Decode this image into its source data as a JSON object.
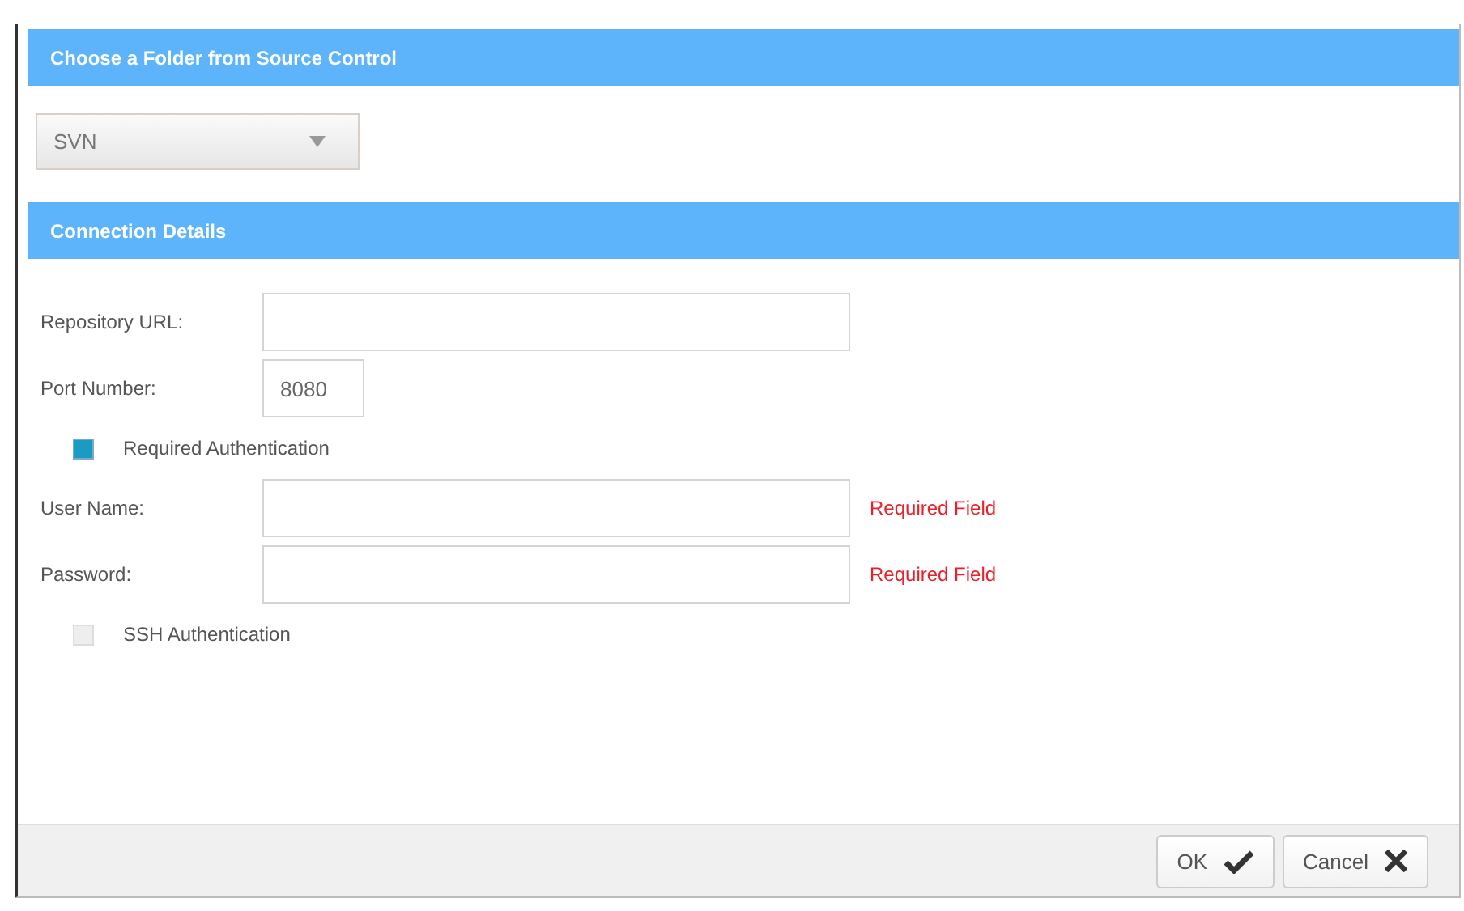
{
  "header": "Choose a Folder from Source Control",
  "source_select": {
    "value": "SVN"
  },
  "section_title": "Connection Details",
  "rows": [
    {
      "kind": "field",
      "label": "Repository URL:"
    },
    {
      "kind": "short_field",
      "label": "Port Number:",
      "value": "8080"
    },
    {
      "kind": "checkbox",
      "label": "Required Authentication",
      "checked": true
    },
    {
      "kind": "field",
      "label": "User Name:",
      "error": "Required Field"
    },
    {
      "kind": "field",
      "label": "Password:",
      "error": "Required Field"
    },
    {
      "kind": "checkbox",
      "label": "SSH Authentication",
      "checked": false
    }
  ],
  "buttons": [
    {
      "label": "OK",
      "kind": "confirm"
    },
    {
      "label": "Cancel",
      "kind": "cancel"
    }
  ]
}
